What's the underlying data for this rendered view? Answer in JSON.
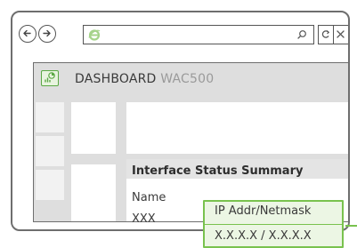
{
  "browser": {
    "back_icon": "arrow-left-circle-icon",
    "forward_icon": "arrow-right-circle-icon",
    "site_icon": "browser-e-icon",
    "search_icon": "search-icon",
    "refresh_icon": "refresh-icon",
    "close_icon": "close-icon"
  },
  "header": {
    "icon": "dashboard-icon",
    "title": "DASHBOARD",
    "model": "WAC500"
  },
  "panel": {
    "title": "Interface Status Summary",
    "columns": [
      "Name",
      "IP Addr/Netmask"
    ],
    "rows": [
      [
        "XXX",
        "X.X.X.X / X.X.X.X"
      ]
    ]
  },
  "colors": {
    "highlight_border": "#79c24e",
    "highlight_fill": "#ecf6e4",
    "dashboard_icon": "#5aa844"
  }
}
